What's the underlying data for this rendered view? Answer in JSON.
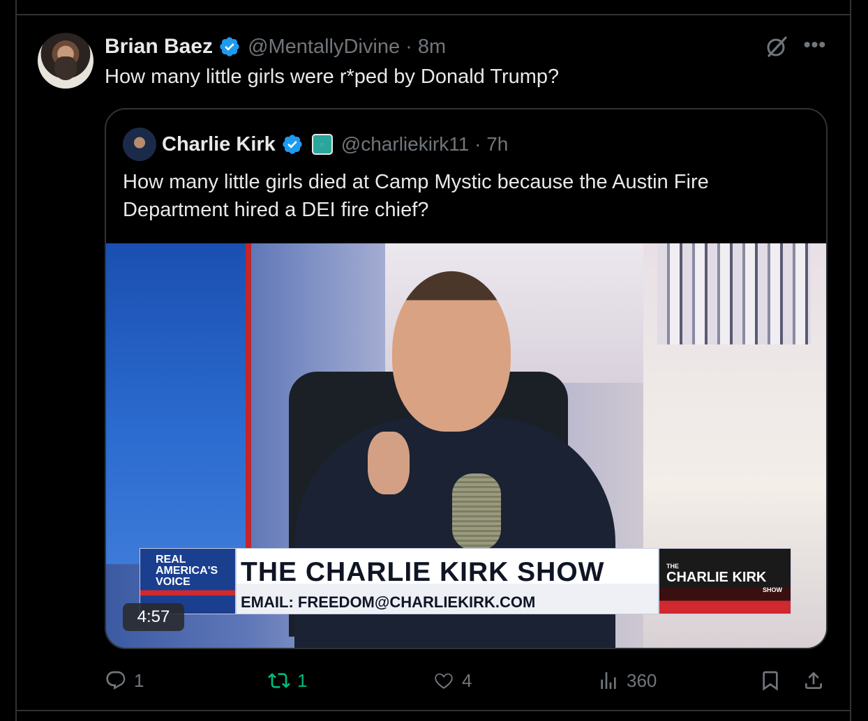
{
  "tweet": {
    "author_name": "Brian Baez",
    "handle_time": "@MentallyDivine · 8m",
    "text": "How many little girls were r*ped by Donald Trump?"
  },
  "quoted": {
    "author_name": "Charlie Kirk",
    "handle_time": "@charliekirk11 · 7h",
    "text": "How many little girls died at Camp Mystic because the Austin Fire Department hired a DEI fire chief?",
    "video": {
      "duration": "4:57",
      "lower_third_title": "THE CHARLIE KIRK SHOW",
      "lower_third_email": "EMAIL: FREEDOM@CHARLIEKIRK.COM",
      "network_logo": "REAL AMERICA'S VOICE",
      "show_logo_small": "THE",
      "show_logo": "CHARLIE KIRK",
      "show_logo_sub": "SHOW"
    }
  },
  "actions": {
    "replies": "1",
    "reposts": "1",
    "likes": "4",
    "views": "360"
  },
  "colors": {
    "background": "#000000",
    "text": "#e7e9ea",
    "muted": "#71767b",
    "verified": "#1d9bf0",
    "repost_active": "#00ba7c",
    "border": "#2f3336"
  },
  "icons": [
    "verified-badge-icon",
    "grok-icon",
    "more-icon",
    "reply-icon",
    "repost-icon",
    "like-icon",
    "views-icon",
    "bookmark-icon",
    "share-icon"
  ]
}
